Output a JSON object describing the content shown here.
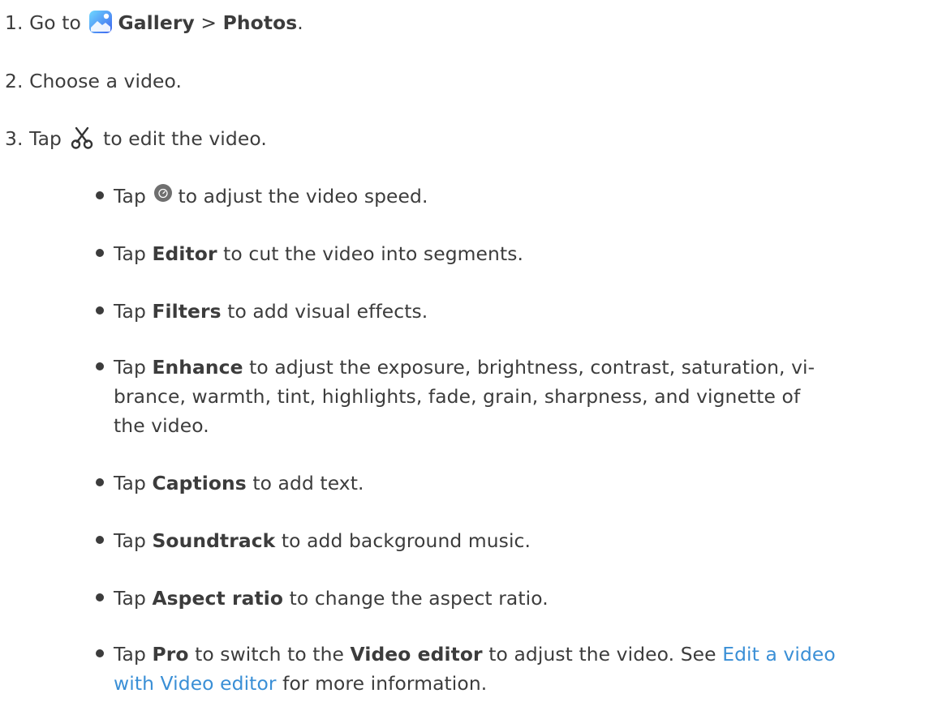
{
  "steps": [
    {
      "num": "1.",
      "pre": "Go to",
      "app": "Gallery",
      "sep": ">",
      "album": "Photos",
      "end": "."
    },
    {
      "num": "2.",
      "text": "Choose a video."
    },
    {
      "num": "3.",
      "pre": "Tap",
      "post": "to edit the video."
    }
  ],
  "bullets": [
    {
      "pre": "Tap",
      "post": "to adjust the video speed."
    },
    {
      "pre": "Tap",
      "bold": "Editor",
      "post": "to cut the video into segments."
    },
    {
      "pre": "Tap",
      "bold": "Filters",
      "post": "to add visual effects."
    },
    {
      "pre": "Tap",
      "bold": "Enhance",
      "post_line1": "to adjust the exposure, brightness, contrast, saturation, vi-",
      "post_line2": "brance, warmth, tint, highlights, fade, grain, sharpness, and vignette of",
      "post_line3": "the video."
    },
    {
      "pre": "Tap",
      "bold": "Captions",
      "post": "to add text."
    },
    {
      "pre": "Tap",
      "bold": "Soundtrack",
      "post": "to add background music."
    },
    {
      "pre": "Tap",
      "bold": "Aspect ratio",
      "post": "to change the aspect ratio."
    },
    {
      "pre": "Tap",
      "bold": "Pro",
      "mid": "to switch to the",
      "bold2": "Video editor",
      "mid2": "to adjust the video. See",
      "link_line1": "Edit a video",
      "link_line2": "with Video editor",
      "post": "for more information."
    }
  ],
  "colors": {
    "text": "#3c3c3c",
    "link": "#3a8fd6",
    "gallery_icon_top": "#5fd0ff",
    "gallery_icon_bottom": "#3d6cf0"
  },
  "icons": {
    "gallery": "gallery-app-icon",
    "edit": "scissors-icon",
    "speed": "speed-icon"
  }
}
